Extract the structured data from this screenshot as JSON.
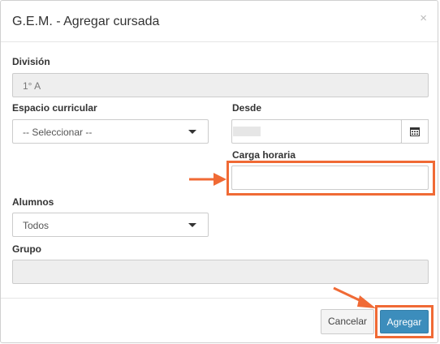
{
  "modal": {
    "title": "G.E.M. - Agregar cursada",
    "close_symbol": "×"
  },
  "form": {
    "division": {
      "label": "División",
      "value": "1° A"
    },
    "espacio": {
      "label": "Espacio curricular",
      "selected": "-- Seleccionar --"
    },
    "desde": {
      "label": "Desde",
      "value": ""
    },
    "carga": {
      "label": "Carga horaria",
      "value": ""
    },
    "alumnos": {
      "label": "Alumnos",
      "selected": "Todos"
    },
    "grupo": {
      "label": "Grupo",
      "value": ""
    }
  },
  "footer": {
    "cancel_label": "Cancelar",
    "add_label": "Agregar"
  },
  "annotation_color": "#f06a35",
  "icons": [
    "close-icon",
    "calendar-icon",
    "chevron-down-icon",
    "arrow-icon"
  ]
}
